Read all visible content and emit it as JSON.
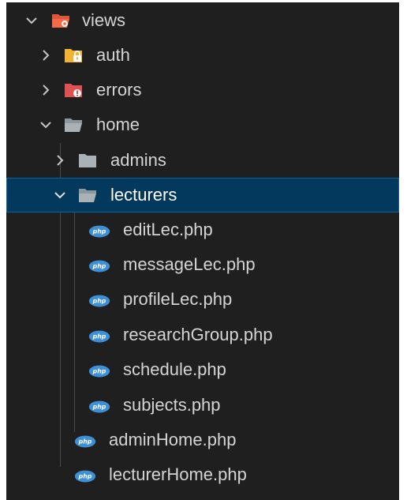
{
  "explorer": {
    "items": [
      {
        "label": "views",
        "type": "folder",
        "expanded": true
      },
      {
        "label": "auth",
        "type": "folder",
        "expanded": false
      },
      {
        "label": "errors",
        "type": "folder",
        "expanded": false
      },
      {
        "label": "home",
        "type": "folder",
        "expanded": true
      },
      {
        "label": "admins",
        "type": "folder",
        "expanded": false
      },
      {
        "label": "lecturers",
        "type": "folder",
        "expanded": true,
        "selected": true
      },
      {
        "label": "editLec.php",
        "type": "file"
      },
      {
        "label": "messageLec.php",
        "type": "file"
      },
      {
        "label": "profileLec.php",
        "type": "file"
      },
      {
        "label": "researchGroup.php",
        "type": "file"
      },
      {
        "label": "schedule.php",
        "type": "file"
      },
      {
        "label": "subjects.php",
        "type": "file"
      },
      {
        "label": "adminHome.php",
        "type": "file"
      },
      {
        "label": "lecturerHome.php",
        "type": "file"
      }
    ]
  },
  "icons": {
    "views": "folder-views-open-icon",
    "auth": "folder-auth-icon",
    "errors": "folder-errors-icon",
    "home": "folder-open-icon",
    "admins": "folder-icon",
    "lecturers": "folder-open-icon",
    "php": "php-file-icon"
  },
  "colors": {
    "background": "#1f1f1f",
    "selection": "#04395e",
    "text": "#d4d4d4",
    "php_icon": "#3d8fd6",
    "views_icon": "#f26b4b",
    "auth_icon": "#f2b233",
    "errors_icon": "#e05252",
    "folder_grey": "#aab2b8"
  }
}
